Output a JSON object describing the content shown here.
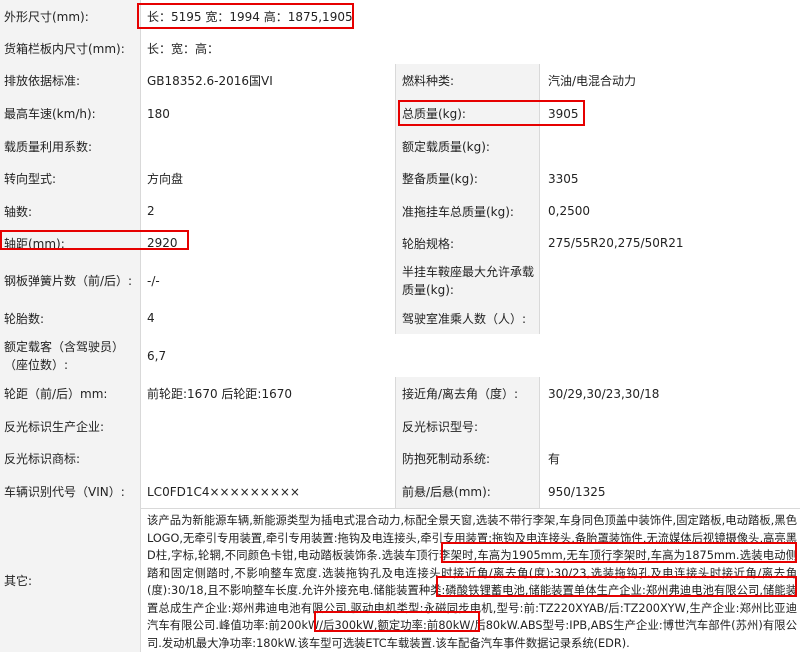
{
  "rows": [
    {
      "l1": "外形尺寸(mm):",
      "v1": "长：5195 宽：1994 高：1875,1905"
    },
    {
      "l1": "货箱栏板内尺寸(mm):",
      "v1": "长：宽：高："
    },
    {
      "l1": "排放依据标准:",
      "v1": "GB18352.6-2016国VI",
      "l2": "燃料种类:",
      "v2": "汽油/电混合动力"
    },
    {
      "l1": "最高车速(km/h):",
      "v1": "180",
      "l2": "总质量(kg):",
      "v2": "3905"
    },
    {
      "l1": "载质量利用系数:",
      "v1": "",
      "l2": "额定载质量(kg):",
      "v2": ""
    },
    {
      "l1": "转向型式:",
      "v1": "方向盘",
      "l2": "整备质量(kg):",
      "v2": "3305"
    },
    {
      "l1": "轴数:",
      "v1": "2",
      "l2": "准拖挂车总质量(kg):",
      "v2": "0,2500"
    },
    {
      "l1": "轴距(mm):",
      "v1": "2920",
      "l2": "轮胎规格:",
      "v2": "275/55R20,275/50R21"
    },
    {
      "l1": "钢板弹簧片数（前/后）:",
      "v1": "-/-",
      "l2": "半挂车鞍座最大允许承载质量(kg):",
      "v2": ""
    },
    {
      "l1": "轮胎数:",
      "v1": "4",
      "l2": "驾驶室准乘人数（人）:",
      "v2": ""
    },
    {
      "l1": "额定载客（含驾驶员）（座位数）:",
      "v1": "6,7"
    },
    {
      "l1": "轮距（前/后）mm:",
      "v1": "前轮距:1670 后轮距:1670",
      "l2": "接近角/离去角（度）:",
      "v2": "30/29,30/23,30/18"
    },
    {
      "l1": "反光标识生产企业:",
      "v1": "",
      "l2": "反光标识型号:",
      "v2": ""
    },
    {
      "l1": "反光标识商标:",
      "v1": "",
      "l2": "防抱死制动系统:",
      "v2": "有"
    },
    {
      "l1": "车辆识别代号（VIN）:",
      "v1": "LC0FD1C4×××××××××",
      "l2": "前悬/后悬(mm):",
      "v2": "950/1325"
    }
  ],
  "other": {
    "label": "其它:",
    "text": "该产品为新能源车辆,新能源类型为插电式混合动力,标配全景天窗,选装不带行李架,车身同色顶盖中装饰件,固定踏板,电动踏板,黑色LOGO,无牵引专用装置,牵引专用装置:拖钩及电连接头,牵引专用装置:拖钩及电连接头,备胎罩装饰件,无流媒体后视镜摄像头,高亮黑D柱,字标,轮辋,不同颜色卡钳,电动踏板装饰条.选装车顶行李架时,车高为1905mm,无车顶行李架时,车高为1875mm.选装电动侧踏和固定侧踏时,不影响整车宽度.选装拖钩孔及电连接头时接近角/离去角(度):30/23,选装拖钩孔及电连接头时接近角/离去角(度):30/18,且不影响整车长度.允许外接充电.储能装置种类:磷酸铁锂蓄电池,储能装置单体生产企业:郑州弗迪电池有限公司,储能装置总成生产企业:郑州弗迪电池有限公司.驱动电机类型:永磁同步电机,型号:前:TZ220XYAB/后:TZ200XYW,生产企业:郑州比亚迪汽车有限公司.峰值功率:前200kW/后300kW,额定功率:前80kW/后80kW.ABS型号:IPB,ABS生产企业:博世汽车部件(苏州)有限公司.发动机最大净功率:180kW.该车型可选装ETC车载装置.该车配备汽车事件数据记录系统(EDR)."
  },
  "colors": {
    "highlight": "#e60000",
    "label_bg": "#f3f3f3",
    "grid": "#d9d9d9"
  }
}
